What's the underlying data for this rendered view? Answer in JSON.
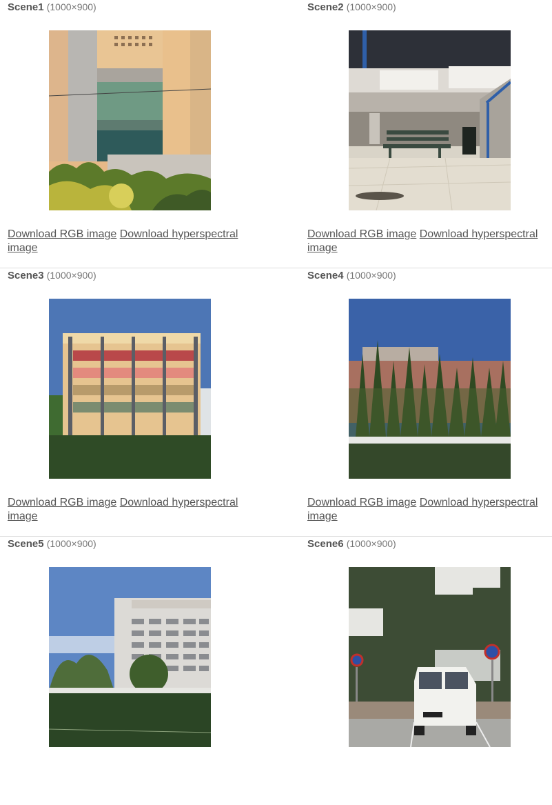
{
  "scenes": [
    {
      "name": "Scene1",
      "dims": "(1000×900)",
      "rgb_label": "Download RGB image",
      "hs_label": "Download hyperspectral image"
    },
    {
      "name": "Scene2",
      "dims": "(1000×900)",
      "rgb_label": "Download RGB image",
      "hs_label": "Download hyperspectral image"
    },
    {
      "name": "Scene3",
      "dims": "(1000×900)",
      "rgb_label": "Download RGB image",
      "hs_label": "Download hyperspectral image"
    },
    {
      "name": "Scene4",
      "dims": "(1000×900)",
      "rgb_label": "Download RGB image",
      "hs_label": "Download hyperspectral image"
    },
    {
      "name": "Scene5",
      "dims": "(1000×900)"
    },
    {
      "name": "Scene6",
      "dims": "(1000×900)"
    }
  ]
}
